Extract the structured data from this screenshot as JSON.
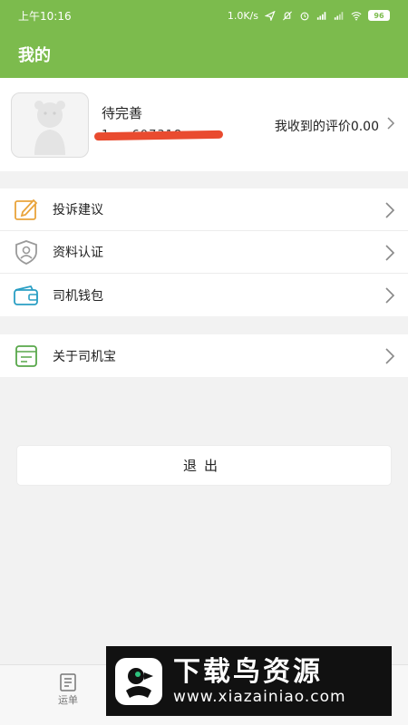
{
  "status_bar": {
    "time": "上午10:16",
    "network_speed": "1.0K/s",
    "battery_level": "96",
    "icons": [
      "location-icon",
      "mute-bell-icon",
      "alarm-icon",
      "signal-hd-icon",
      "signal-icon",
      "wifi-icon",
      "battery-icon"
    ]
  },
  "header": {
    "title": "我的"
  },
  "profile": {
    "name": "待完善",
    "phone": "1 … 607318",
    "rating_label": "我收到的评价0.00"
  },
  "menu": {
    "group1": [
      {
        "label": "投诉建议",
        "icon": "edit-icon"
      },
      {
        "label": "资料认证",
        "icon": "id-shield-icon"
      },
      {
        "label": "司机钱包",
        "icon": "wallet-icon"
      }
    ],
    "group2": [
      {
        "label": "关于司机宝",
        "icon": "info-card-icon"
      }
    ]
  },
  "logout_label": "退出",
  "tab_bar": {
    "tabs": [
      {
        "label": "运单",
        "icon": "waybill-icon"
      }
    ]
  },
  "watermark": {
    "title": "下载鸟资源",
    "url": "www.xiazainiao.com"
  },
  "colors": {
    "brand_green": "#7cbb4d",
    "icon_orange": "#e9a43b",
    "icon_teal": "#2a9fc4",
    "icon_green": "#58a74a"
  }
}
